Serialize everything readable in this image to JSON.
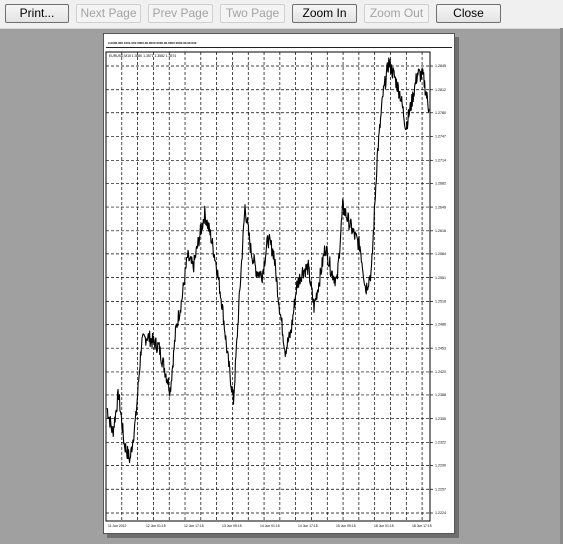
{
  "toolbar": {
    "print_label": "Print...",
    "next_page_label": "Next Page",
    "prev_page_label": "Prev Page",
    "two_page_label": "Two Page",
    "zoom_in_label": "Zoom In",
    "zoom_out_label": "Zoom Out",
    "close_label": "Close"
  },
  "page": {
    "header_text": "#.0000.000  1001.000 0000.00.0000 0000.00.0000 0000.00.00.000",
    "chart_symbol_line": "EURUSD,M15  1.3580 1.3571 1.3582 1.3574"
  },
  "chart_data": {
    "type": "line",
    "series": [
      {
        "values": [
          1.237,
          1.2335,
          1.239,
          1.232,
          1.2298,
          1.2355,
          1.246,
          1.247,
          1.2462,
          1.2455,
          1.2425,
          1.2395,
          1.248,
          1.252,
          1.258,
          1.2565,
          1.2605,
          1.264,
          1.261,
          1.257,
          1.2515,
          1.244,
          1.238,
          1.252,
          1.265,
          1.259,
          1.256,
          1.2555,
          1.2605,
          1.2585,
          1.251,
          1.245,
          1.2475,
          1.254,
          1.256,
          1.2565,
          1.251,
          1.255,
          1.2595,
          1.256,
          1.2545,
          1.265,
          1.263,
          1.261,
          1.2595,
          1.2535,
          1.256,
          1.272,
          1.2805,
          1.285,
          1.283,
          1.2805,
          1.276,
          1.2795,
          1.2835,
          1.283,
          1.2785
        ]
      }
    ],
    "y_ticks": [
      "1.2845",
      "1.2812",
      "1.2780",
      "1.2747",
      "1.2714",
      "1.2682",
      "1.2649",
      "1.2616",
      "1.2584",
      "1.2551",
      "1.2518",
      "1.2486",
      "1.2453",
      "1.2420",
      "1.2388",
      "1.2355",
      "1.2322",
      "1.2290",
      "1.2257",
      "1.2224"
    ],
    "x_ticks": [
      "11 Jun 2012",
      "12 Jun 01:15",
      "12 Jun 17:15",
      "13 Jun 09:15",
      "14 Jun 01:15",
      "14 Jun 17:15",
      "15 Jun 09:15",
      "18 Jun 01:15",
      "18 Jun 17:15"
    ],
    "grid": true
  }
}
